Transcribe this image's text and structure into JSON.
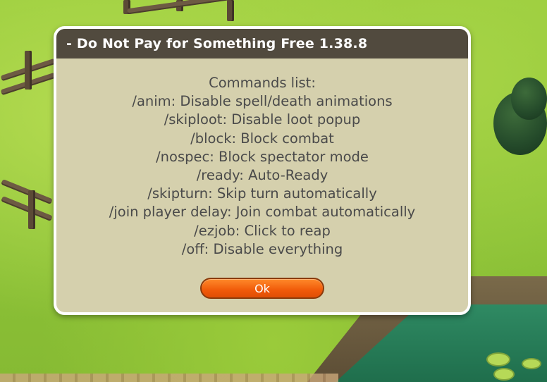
{
  "dialog": {
    "title": "- Do Not Pay for Something Free 1.38.8",
    "commands_header": "Commands list:",
    "commands": [
      "/anim: Disable spell/death animations",
      "/skiploot: Disable loot popup",
      "/block: Block combat",
      "/nospec: Block spectator mode",
      "/ready: Auto-Ready",
      "/skipturn: Skip turn automatically",
      "/join player delay: Join combat automatically",
      "/ezjob: Click to reap",
      "/off: Disable everything"
    ],
    "ok_label": "Ok"
  },
  "colors": {
    "header_bg": "#514a3e",
    "dialog_bg": "#d5d0ad",
    "text": "#4a4a4a",
    "button": "#f05a0a",
    "grass": "#8dc63f"
  }
}
